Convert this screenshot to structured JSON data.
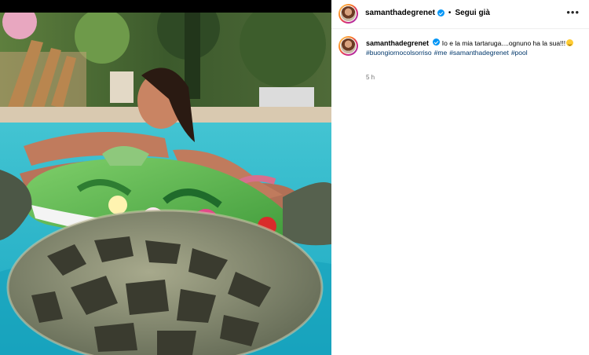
{
  "post": {
    "username": "samanthadegrenet",
    "follow_label": "Segui già",
    "separator": "•",
    "more_icon": "more-horizontal-icon",
    "verified_icon": "verified-badge-icon"
  },
  "caption": {
    "username": "samanthadegrenet",
    "text": "Io e la mia tartaruga....ognuno ha la sua!!!",
    "emoji": "winking-face-emoji",
    "hashtags": [
      "#buongiornocolsorriso",
      "#me",
      "#samanthadegrenet",
      "#pool"
    ],
    "time": "5 h"
  },
  "colors": {
    "verified": "#0095f6",
    "hashtag": "#00376b",
    "time": "#737373",
    "pool": "#2bb6c9"
  }
}
